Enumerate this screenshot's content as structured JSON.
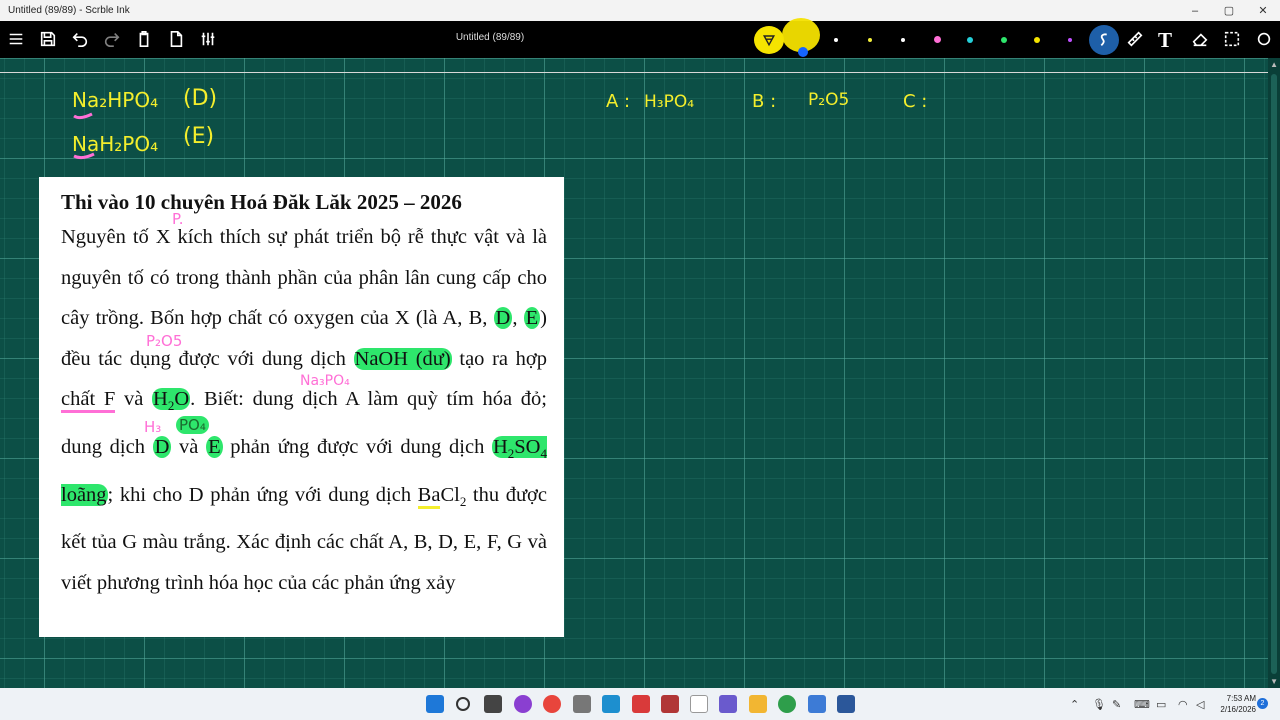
{
  "window": {
    "title": "Untitled (89/89) - Scrble Ink",
    "minimize": "–",
    "maximize": "▢",
    "close": "✕"
  },
  "toolbar": {
    "doc_title": "Untitled (89/89)",
    "text_tool_label": "T",
    "pen_colors": [
      "#2a7bff",
      "#ffffff",
      "#f2ee3a",
      "#ffffff",
      "#ff6fd6",
      "#25d0d9",
      "#2ee66c",
      "#f5e400",
      "#c050ff"
    ]
  },
  "annotations": {
    "d_formula": "Na₂HPO₄",
    "d_label": "(D)",
    "e_formula": "NaH₂PO₄",
    "e_label": "(E)",
    "a_label": "A :",
    "a_value": "H₃PO₄",
    "b_label": "B :",
    "b_value": "P₂O5",
    "c_label": "C :",
    "x_note": "P.",
    "p2o5_note": "P₂O5",
    "na3po4_note": "Na₃PO₄",
    "h3_note": "H₃",
    "po4_note": "PO₄"
  },
  "question": {
    "title": "Thi vào 10 chuyên Hoá Đăk Lăk 2025 – 2026",
    "p1": "Nguyên tố X kích thích sự phát triển bộ rễ thực vật và là nguyên tố có trong thành phần của phân lân cung cấp cho cây trồng. Bốn hợp chất có oxygen của X (là A, B, ",
    "d": "D",
    "comma": ", ",
    "e": "E",
    "p2": ") đều tác dụng được với dung dịch ",
    "naoh": "NaOH (dư)",
    "p3": " tạo ra hợp ",
    "chatf": "chất F",
    "p4": " và ",
    "h2o_h": "H",
    "h2o_sub": "2",
    "h2o_o": "O",
    "p5": ". Biết: dung dịch A làm quỳ tím hóa đỏ; dung dịch ",
    "d2": "D",
    "p6": " và ",
    "e2": "E",
    "p7": " phản ứng được với dung dịch ",
    "h2so4_a": "H",
    "h2so4_sub1": "2",
    "h2so4_b": "SO",
    "h2so4_sub2": "4",
    "h2so4_c": " loãng",
    "p8": "; khi cho D phản ứng với dung dịch ",
    "ba": "Ba",
    "cl": "Cl",
    "cl_sub": "2",
    "p9": " thu được kết tủa G màu trắng. Xác định các chất A, B, D, E, F, G và viết phương trình hóa học của các phản ứng xảy"
  },
  "taskbar": {
    "time": "7:53 AM",
    "date": "2/16/2026",
    "notif_count": "2"
  }
}
